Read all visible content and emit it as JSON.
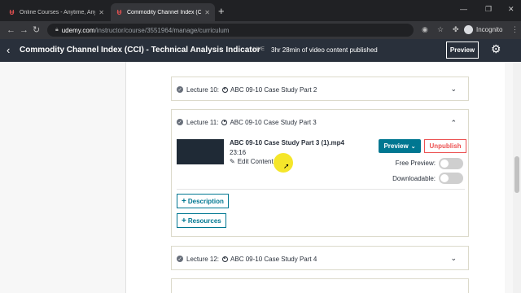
{
  "browser": {
    "tabs": [
      {
        "title": "Online Courses - Anytime, Anywhere",
        "active": false
      },
      {
        "title": "Commodity Channel Index (CCI) - Te",
        "active": true
      }
    ],
    "url_host": "udemy.com",
    "url_path": "/instructor/course/3551964/manage/curriculum",
    "profile_label": "Incognito"
  },
  "header": {
    "course_title": "Commodity Channel Index (CCI) - Technical Analysis Indicator",
    "live_badge": "LIVE",
    "video_status": "3hr 28min of video content published",
    "preview_label": "Preview"
  },
  "lectures": [
    {
      "number": "Lecture 10:",
      "title": "ABC 09-10 Case Study Part 2",
      "expanded": false
    },
    {
      "number": "Lecture 11:",
      "title": "ABC 09-10 Case Study Part 3",
      "expanded": true
    },
    {
      "number": "Lecture 12:",
      "title": "ABC 09-10 Case Study Part 4",
      "expanded": false
    }
  ],
  "expanded_lecture": {
    "file_name": "ABC 09-10 Case Study Part 3 (1).mp4",
    "duration": "23:16",
    "edit_label": "Edit Content",
    "preview_label": "Preview",
    "unpublish_label": "Unpublish",
    "free_preview_label": "Free Preview:",
    "downloadable_label": "Downloadable:",
    "description_label": "Description",
    "resources_label": "Resources"
  },
  "colors": {
    "accent": "#007791",
    "danger": "#ec5252",
    "header_bg": "#29303b"
  }
}
